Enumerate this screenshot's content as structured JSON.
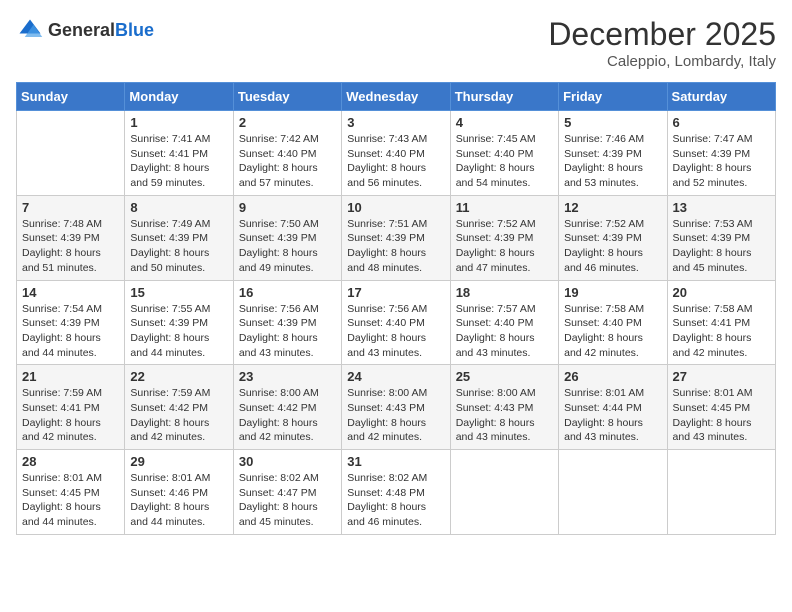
{
  "logo": {
    "general": "General",
    "blue": "Blue"
  },
  "title": {
    "month": "December 2025",
    "location": "Caleppio, Lombardy, Italy"
  },
  "weekdays": [
    "Sunday",
    "Monday",
    "Tuesday",
    "Wednesday",
    "Thursday",
    "Friday",
    "Saturday"
  ],
  "weeks": [
    [
      {
        "day": "",
        "info": ""
      },
      {
        "day": "1",
        "info": "Sunrise: 7:41 AM\nSunset: 4:41 PM\nDaylight: 8 hours\nand 59 minutes."
      },
      {
        "day": "2",
        "info": "Sunrise: 7:42 AM\nSunset: 4:40 PM\nDaylight: 8 hours\nand 57 minutes."
      },
      {
        "day": "3",
        "info": "Sunrise: 7:43 AM\nSunset: 4:40 PM\nDaylight: 8 hours\nand 56 minutes."
      },
      {
        "day": "4",
        "info": "Sunrise: 7:45 AM\nSunset: 4:40 PM\nDaylight: 8 hours\nand 54 minutes."
      },
      {
        "day": "5",
        "info": "Sunrise: 7:46 AM\nSunset: 4:39 PM\nDaylight: 8 hours\nand 53 minutes."
      },
      {
        "day": "6",
        "info": "Sunrise: 7:47 AM\nSunset: 4:39 PM\nDaylight: 8 hours\nand 52 minutes."
      }
    ],
    [
      {
        "day": "7",
        "info": "Sunrise: 7:48 AM\nSunset: 4:39 PM\nDaylight: 8 hours\nand 51 minutes."
      },
      {
        "day": "8",
        "info": "Sunrise: 7:49 AM\nSunset: 4:39 PM\nDaylight: 8 hours\nand 50 minutes."
      },
      {
        "day": "9",
        "info": "Sunrise: 7:50 AM\nSunset: 4:39 PM\nDaylight: 8 hours\nand 49 minutes."
      },
      {
        "day": "10",
        "info": "Sunrise: 7:51 AM\nSunset: 4:39 PM\nDaylight: 8 hours\nand 48 minutes."
      },
      {
        "day": "11",
        "info": "Sunrise: 7:52 AM\nSunset: 4:39 PM\nDaylight: 8 hours\nand 47 minutes."
      },
      {
        "day": "12",
        "info": "Sunrise: 7:52 AM\nSunset: 4:39 PM\nDaylight: 8 hours\nand 46 minutes."
      },
      {
        "day": "13",
        "info": "Sunrise: 7:53 AM\nSunset: 4:39 PM\nDaylight: 8 hours\nand 45 minutes."
      }
    ],
    [
      {
        "day": "14",
        "info": "Sunrise: 7:54 AM\nSunset: 4:39 PM\nDaylight: 8 hours\nand 44 minutes."
      },
      {
        "day": "15",
        "info": "Sunrise: 7:55 AM\nSunset: 4:39 PM\nDaylight: 8 hours\nand 44 minutes."
      },
      {
        "day": "16",
        "info": "Sunrise: 7:56 AM\nSunset: 4:39 PM\nDaylight: 8 hours\nand 43 minutes."
      },
      {
        "day": "17",
        "info": "Sunrise: 7:56 AM\nSunset: 4:40 PM\nDaylight: 8 hours\nand 43 minutes."
      },
      {
        "day": "18",
        "info": "Sunrise: 7:57 AM\nSunset: 4:40 PM\nDaylight: 8 hours\nand 43 minutes."
      },
      {
        "day": "19",
        "info": "Sunrise: 7:58 AM\nSunset: 4:40 PM\nDaylight: 8 hours\nand 42 minutes."
      },
      {
        "day": "20",
        "info": "Sunrise: 7:58 AM\nSunset: 4:41 PM\nDaylight: 8 hours\nand 42 minutes."
      }
    ],
    [
      {
        "day": "21",
        "info": "Sunrise: 7:59 AM\nSunset: 4:41 PM\nDaylight: 8 hours\nand 42 minutes."
      },
      {
        "day": "22",
        "info": "Sunrise: 7:59 AM\nSunset: 4:42 PM\nDaylight: 8 hours\nand 42 minutes."
      },
      {
        "day": "23",
        "info": "Sunrise: 8:00 AM\nSunset: 4:42 PM\nDaylight: 8 hours\nand 42 minutes."
      },
      {
        "day": "24",
        "info": "Sunrise: 8:00 AM\nSunset: 4:43 PM\nDaylight: 8 hours\nand 42 minutes."
      },
      {
        "day": "25",
        "info": "Sunrise: 8:00 AM\nSunset: 4:43 PM\nDaylight: 8 hours\nand 43 minutes."
      },
      {
        "day": "26",
        "info": "Sunrise: 8:01 AM\nSunset: 4:44 PM\nDaylight: 8 hours\nand 43 minutes."
      },
      {
        "day": "27",
        "info": "Sunrise: 8:01 AM\nSunset: 4:45 PM\nDaylight: 8 hours\nand 43 minutes."
      }
    ],
    [
      {
        "day": "28",
        "info": "Sunrise: 8:01 AM\nSunset: 4:45 PM\nDaylight: 8 hours\nand 44 minutes."
      },
      {
        "day": "29",
        "info": "Sunrise: 8:01 AM\nSunset: 4:46 PM\nDaylight: 8 hours\nand 44 minutes."
      },
      {
        "day": "30",
        "info": "Sunrise: 8:02 AM\nSunset: 4:47 PM\nDaylight: 8 hours\nand 45 minutes."
      },
      {
        "day": "31",
        "info": "Sunrise: 8:02 AM\nSunset: 4:48 PM\nDaylight: 8 hours\nand 46 minutes."
      },
      {
        "day": "",
        "info": ""
      },
      {
        "day": "",
        "info": ""
      },
      {
        "day": "",
        "info": ""
      }
    ]
  ]
}
